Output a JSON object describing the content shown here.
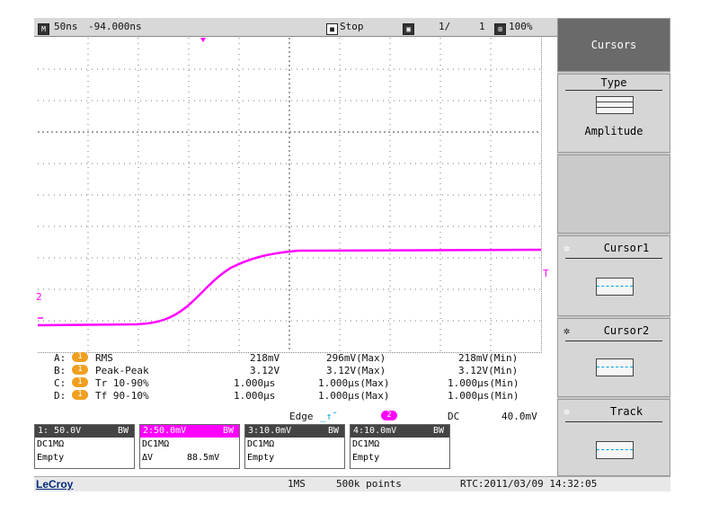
{
  "topbar": {
    "timebase": "50ns",
    "delay": "-94.000ns",
    "run_state": "Stop",
    "sweeps": "1/",
    "sweeps_total": "1",
    "zoom": "100%"
  },
  "menu": {
    "title": "Cursors",
    "type_label": "Type",
    "type_value": "Amplitude",
    "cursor1_label": "Cursor1",
    "cursor2_label": "Cursor2",
    "track_label": "Track"
  },
  "markers": {
    "left_marker": "2",
    "right_marker": "T"
  },
  "measurements": [
    {
      "slot": "A:",
      "ch": "1",
      "name": "RMS",
      "value": "218mV",
      "max": "296mV(Max)",
      "min": "218mV(Min)"
    },
    {
      "slot": "B:",
      "ch": "1",
      "name": "Peak-Peak",
      "value": "3.12V",
      "max": "3.12V(Max)",
      "min": "3.12V(Min)"
    },
    {
      "slot": "C:",
      "ch": "1",
      "name": "Tr 10-90%",
      "value": "1.000µs",
      "max": "1.000µs(Max)",
      "min": "1.000µs(Min)"
    },
    {
      "slot": "D:",
      "ch": "1",
      "name": "Tf 90-10%",
      "value": "1.000µs",
      "max": "1.000µs(Max)",
      "min": "1.000µs(Min)"
    }
  ],
  "trigger": {
    "mode": "Edge",
    "channel": "2",
    "coupling": "DC",
    "level": "40.0mV"
  },
  "channels": [
    {
      "head": "1: 50.0V",
      "bw": "BW",
      "coupling": "DC1MΩ",
      "info": "Empty",
      "extra": ""
    },
    {
      "head": "2:50.0mV",
      "bw": "BW",
      "coupling": "DC1MΩ",
      "info": "ΔV",
      "extra": "88.5mV"
    },
    {
      "head": "3:10.0mV",
      "bw": "BW",
      "coupling": "DC1MΩ",
      "info": "Empty",
      "extra": ""
    },
    {
      "head": "4:10.0mV",
      "bw": "BW",
      "coupling": "DC1MΩ",
      "info": "Empty",
      "extra": ""
    }
  ],
  "bottom": {
    "brand": "LeCroy",
    "sample_rate": "1MS",
    "points": "500k points",
    "rtc": "RTC:2011/03/09 14:32:05"
  },
  "colors": {
    "trace": "#ff00ff",
    "channel1": "#f0a020",
    "header": "#6a6a6a"
  }
}
